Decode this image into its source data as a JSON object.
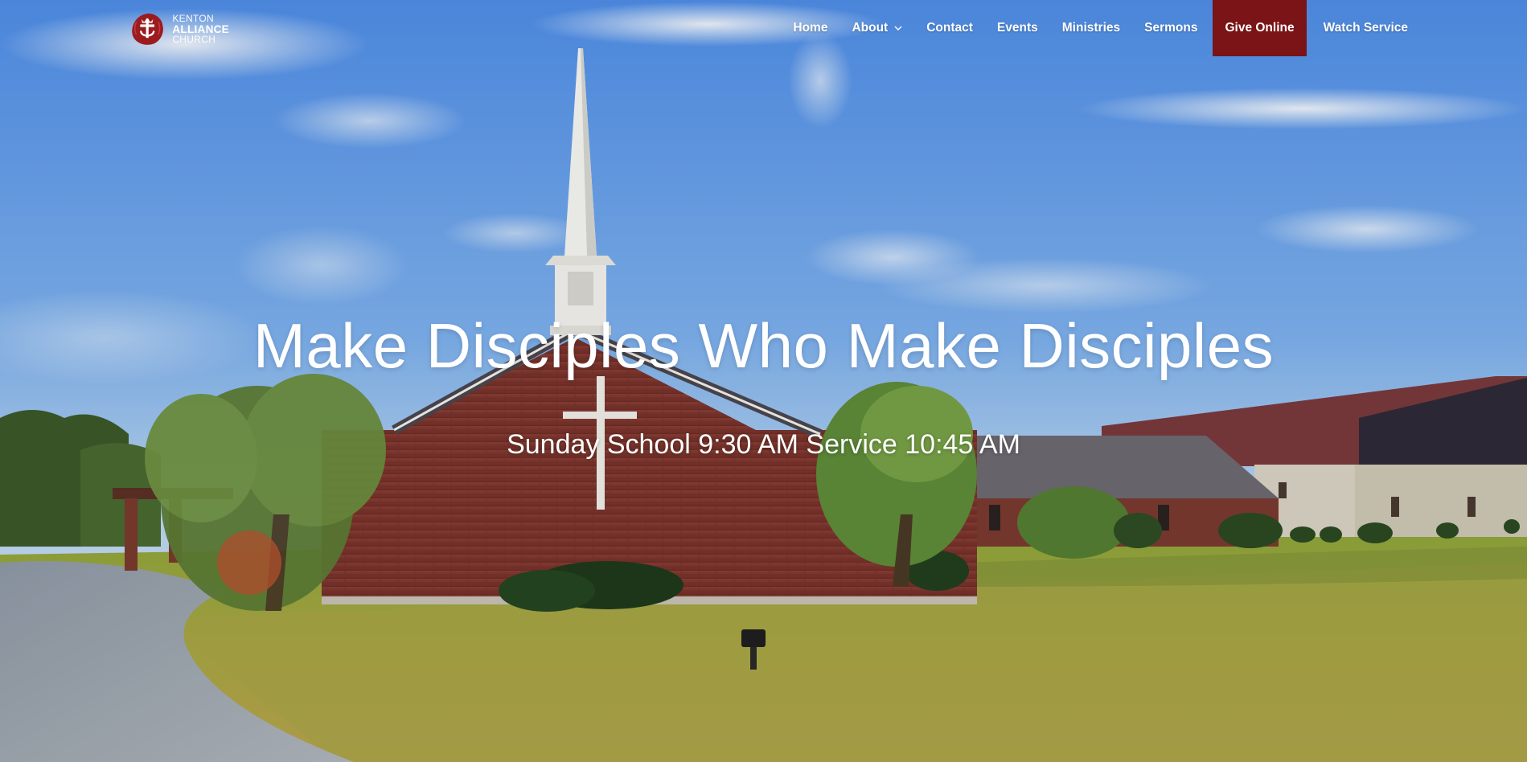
{
  "logo": {
    "line1": "KENTON",
    "line2": "ALLIANCE",
    "line3": "CHURCH",
    "mark_icon": "alliance-cross-crown-icon",
    "mark_color": "#9b1b1f"
  },
  "nav": {
    "items": [
      {
        "label": "Home"
      },
      {
        "label": "About",
        "has_dropdown": true,
        "icon": "chevron-down-icon"
      },
      {
        "label": "Contact"
      },
      {
        "label": "Events"
      },
      {
        "label": "Ministries"
      },
      {
        "label": "Sermons"
      },
      {
        "label": "Give Online",
        "highlight": true
      },
      {
        "label": "Watch Service"
      }
    ],
    "highlight_color": "#7a1416"
  },
  "hero": {
    "headline": "Make Disciples Who Make Disciples",
    "subheadline": "Sunday School 9:30 AM Service 10:45 AM"
  }
}
